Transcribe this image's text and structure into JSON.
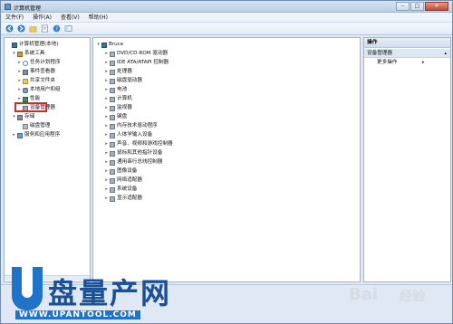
{
  "window": {
    "title": "计算机管理"
  },
  "menubar": [
    "文件(F)",
    "操作(A)",
    "查看(V)",
    "帮助(H)"
  ],
  "toolbar": [
    "back-icon",
    "forward-icon",
    "up-folder-icon",
    "properties-icon",
    "help-icon",
    "view-icon"
  ],
  "left_tree": {
    "items": [
      {
        "label": "计算机管理(本地)",
        "icon": "computer-icon",
        "level": 0,
        "expander": ""
      },
      {
        "label": "系统工具",
        "icon": "tools-icon",
        "level": 1,
        "expander": "▾"
      },
      {
        "label": "任务计划程序",
        "icon": "clock-icon",
        "level": 2,
        "expander": "▸"
      },
      {
        "label": "事件查看器",
        "icon": "event-icon",
        "level": 2,
        "expander": "▸"
      },
      {
        "label": "共享文件夹",
        "icon": "folder-icon",
        "level": 2,
        "expander": "▸"
      },
      {
        "label": "本地用户和组",
        "icon": "users-icon",
        "level": 2,
        "expander": "▸"
      },
      {
        "label": "性能",
        "icon": "performance-icon",
        "level": 2,
        "expander": "▸"
      },
      {
        "label": "设备管理器",
        "icon": "device-manager-icon",
        "level": 2,
        "expander": ""
      },
      {
        "label": "存储",
        "icon": "storage-icon",
        "level": 1,
        "expander": "▾"
      },
      {
        "label": "磁盘管理",
        "icon": "disk-icon",
        "level": 2,
        "expander": ""
      },
      {
        "label": "服务和应用程序",
        "icon": "services-icon",
        "level": 1,
        "expander": "▸"
      }
    ]
  },
  "center_tree": {
    "root": "Bruce",
    "devices": [
      "DVD/CD-ROM 驱动器",
      "IDE ATA/ATAPI 控制器",
      "处理器",
      "磁盘驱动器",
      "电池",
      "计算机",
      "监视器",
      "键盘",
      "内存技术驱动程序",
      "人体学输入设备",
      "声音、视频和游戏控制器",
      "鼠标和其他指针设备",
      "通用串行总线控制器",
      "图像设备",
      "网络适配器",
      "系统设备",
      "显示适配器"
    ]
  },
  "actions_pane": {
    "title": "操作",
    "section": "设备管理器",
    "more": "更多操作"
  },
  "watermark": {
    "text_cn": "盘量产网",
    "url": "WWW.UPANTOOL.COM",
    "baidu": "Bai",
    "jingyan": "经验"
  },
  "colors": {
    "accent": "#1f73c9",
    "highlight": "#d32a2a",
    "pane_border": "#9eb5d0"
  }
}
